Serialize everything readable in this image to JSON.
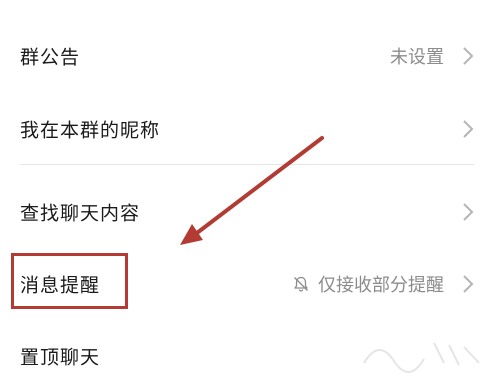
{
  "settings": {
    "items": [
      {
        "label": "群公告",
        "value": "未设置"
      },
      {
        "label": "我在本群的昵称",
        "value": ""
      },
      {
        "label": "查找聊天内容",
        "value": ""
      },
      {
        "label": "消息提醒",
        "value": "仅接收部分提醒"
      },
      {
        "label": "置顶聊天",
        "value": ""
      }
    ]
  },
  "icons": {
    "chevron": "chevron-right-icon",
    "bell": "bell-muted-icon"
  },
  "colors": {
    "highlight": "#b23b33",
    "arrow": "#b23b33",
    "text": "#1a1a1a",
    "secondary": "#8c8c8c"
  }
}
